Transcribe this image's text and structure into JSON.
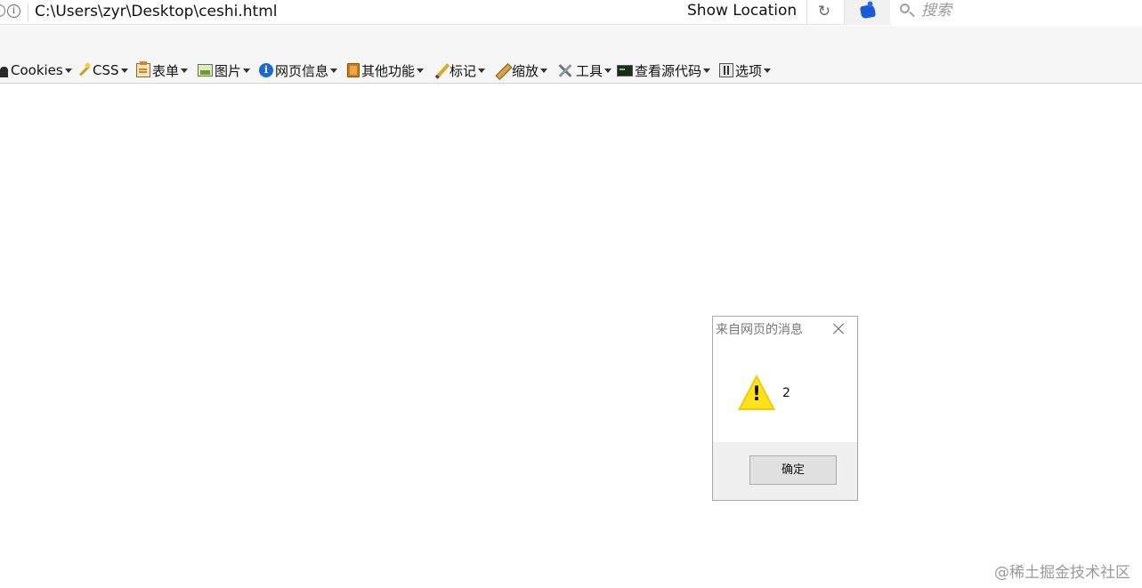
{
  "address_bar": {
    "url": "C:\\Users\\zyr\\Desktop\\ceshi.html",
    "show_location": "Show Location",
    "reload_icon": "reload-icon",
    "extension_icon": "extension-icon",
    "search_placeholder": "搜索",
    "search_icon": "search-icon"
  },
  "dev_toolbar": {
    "items": [
      {
        "label": "Cookies",
        "icon": "cookie-icon"
      },
      {
        "label": "CSS",
        "icon": "css-wand-icon"
      },
      {
        "label": "表单",
        "icon": "clipboard-icon"
      },
      {
        "label": "图片",
        "icon": "image-icon"
      },
      {
        "label": "网页信息",
        "icon": "info-icon"
      },
      {
        "label": "其他功能",
        "icon": "book-icon"
      },
      {
        "label": "标记",
        "icon": "pencil-icon"
      },
      {
        "label": "缩放",
        "icon": "ruler-icon"
      },
      {
        "label": "工具",
        "icon": "tools-icon"
      },
      {
        "label": "查看源代码",
        "icon": "terminal-icon"
      },
      {
        "label": "选项",
        "icon": "options-icon"
      }
    ]
  },
  "dialog": {
    "title": "来自网页的消息",
    "message": "2",
    "icon": "warning-icon",
    "ok_label": "确定"
  },
  "watermark": "@稀土掘金技术社区",
  "colors": {
    "toolbar_bg": "#f6f6f6",
    "dialog_footer_bg": "#f0f0f0",
    "warning_yellow": "#ffe21a"
  }
}
